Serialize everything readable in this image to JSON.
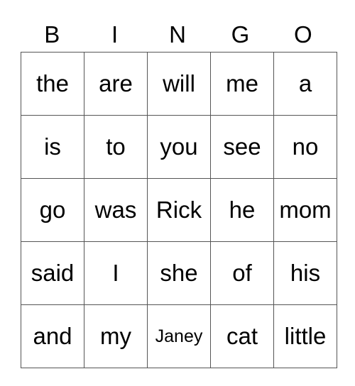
{
  "header": [
    "B",
    "I",
    "N",
    "G",
    "O"
  ],
  "rows": [
    [
      "the",
      "are",
      "will",
      "me",
      "a"
    ],
    [
      "is",
      "to",
      "you",
      "see",
      "no"
    ],
    [
      "go",
      "was",
      "Rick",
      "he",
      "mom"
    ],
    [
      "said",
      "I",
      "she",
      "of",
      "his"
    ],
    [
      "and",
      "my",
      "Janey",
      "cat",
      "little"
    ]
  ]
}
